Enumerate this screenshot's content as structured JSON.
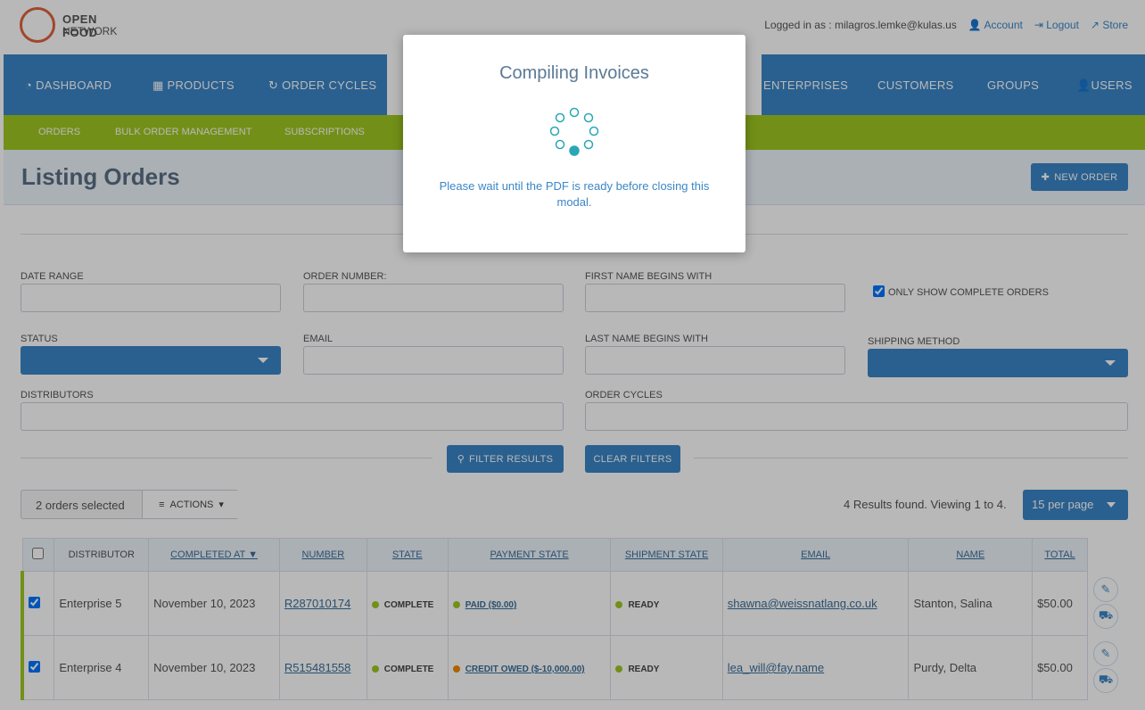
{
  "header": {
    "logo_text_1": "OPEN FOOD",
    "logo_text_2": "NETWORK",
    "logged_in": "Logged in as : milagros.lemke@kulas.us",
    "account": "Account",
    "logout": "Logout",
    "store": "Store"
  },
  "nav": {
    "dashboard": "DASHBOARD",
    "products": "PRODUCTS",
    "order_cycles": "ORDER CYCLES",
    "enterprises": "ENTERPRISES",
    "customers": "CUSTOMERS",
    "groups": "GROUPS",
    "users": "USERS"
  },
  "subnav": {
    "orders": "ORDERS",
    "bulk": "BULK ORDER MANAGEMENT",
    "subscriptions": "SUBSCRIPTIONS"
  },
  "page": {
    "title": "Listing Orders",
    "new_order": "NEW ORDER"
  },
  "filters": {
    "date_range": "DATE RANGE",
    "order_number": "ORDER NUMBER:",
    "first_name": "FIRST NAME BEGINS WITH",
    "only_complete": "ONLY SHOW COMPLETE ORDERS",
    "status": "STATUS",
    "email": "EMAIL",
    "last_name": "LAST NAME BEGINS WITH",
    "shipping_method": "SHIPPING METHOD",
    "distributors": "DISTRIBUTORS",
    "order_cycles": "ORDER CYCLES",
    "filter_results": "FILTER RESULTS",
    "clear_filters": "CLEAR FILTERS"
  },
  "bulk": {
    "selected": "2 orders selected",
    "actions": "ACTIONS",
    "results": "4 Results found. Viewing 1 to 4.",
    "per_page": "15 per page"
  },
  "table": {
    "headers": [
      "DISTRIBUTOR",
      "COMPLETED AT ▼",
      "NUMBER",
      "STATE",
      "PAYMENT STATE",
      "SHIPMENT STATE",
      "EMAIL",
      "NAME",
      "TOTAL"
    ],
    "rows": [
      {
        "distributor": "Enterprise 5",
        "completed": "November 10, 2023",
        "number": "R287010174",
        "state": "COMPLETE",
        "payment": "PAID ($0.00)",
        "payment_color": "#9fc820",
        "shipment": "READY",
        "email": "shawna@weissnatlang.co.uk",
        "name": "Stanton, Salina",
        "total": "$50.00"
      },
      {
        "distributor": "Enterprise 4",
        "completed": "November 10, 2023",
        "number": "R515481558",
        "state": "COMPLETE",
        "payment": "CREDIT OWED ($-10,000.00)",
        "payment_color": "#f08a00",
        "shipment": "READY",
        "email": "lea_will@fay.name",
        "name": "Purdy, Delta",
        "total": "$50.00"
      }
    ]
  },
  "modal": {
    "title": "Compiling Invoices",
    "message": "Please wait until the PDF is ready before closing this modal."
  },
  "colors": {
    "primary": "#3b86c6",
    "green": "#9fc820"
  }
}
